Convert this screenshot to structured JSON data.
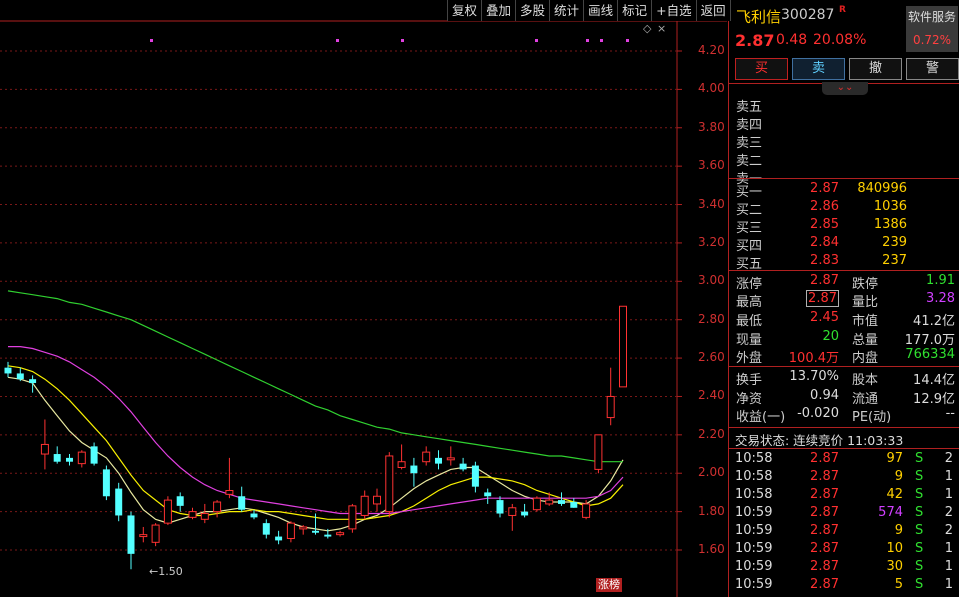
{
  "toolbar": [
    "复权",
    "叠加",
    "多股",
    "统计",
    "画线",
    "标记",
    "+自选",
    "返回"
  ],
  "chart_controls": {
    "diamond": "◇",
    "close": "×"
  },
  "chart_data": {
    "type": "candlestick",
    "yticks": [
      "4.20",
      "4.00",
      "3.80",
      "3.60",
      "3.40",
      "3.20",
      "3.00",
      "2.80",
      "2.60",
      "2.40",
      "2.20",
      "2.00",
      "1.80",
      "1.60"
    ],
    "ylim": [
      1.52,
      4.3
    ],
    "low_annotation": "1.50",
    "badge": "涨榜",
    "candles": [
      {
        "o": 2.55,
        "h": 2.58,
        "l": 2.5,
        "c": 2.52
      },
      {
        "o": 2.52,
        "h": 2.55,
        "l": 2.48,
        "c": 2.49
      },
      {
        "o": 2.49,
        "h": 2.51,
        "l": 2.42,
        "c": 2.47
      },
      {
        "o": 2.1,
        "h": 2.28,
        "l": 2.02,
        "c": 2.15
      },
      {
        "o": 2.1,
        "h": 2.14,
        "l": 2.05,
        "c": 2.06
      },
      {
        "o": 2.08,
        "h": 2.1,
        "l": 2.04,
        "c": 2.06
      },
      {
        "o": 2.05,
        "h": 2.12,
        "l": 2.03,
        "c": 2.11
      },
      {
        "o": 2.14,
        "h": 2.16,
        "l": 2.04,
        "c": 2.05
      },
      {
        "o": 2.02,
        "h": 2.04,
        "l": 1.86,
        "c": 1.88
      },
      {
        "o": 1.92,
        "h": 1.95,
        "l": 1.75,
        "c": 1.78
      },
      {
        "o": 1.78,
        "h": 1.8,
        "l": 1.5,
        "c": 1.58
      },
      {
        "o": 1.67,
        "h": 1.72,
        "l": 1.64,
        "c": 1.68
      },
      {
        "o": 1.64,
        "h": 1.74,
        "l": 1.62,
        "c": 1.73
      },
      {
        "o": 1.74,
        "h": 1.88,
        "l": 1.73,
        "c": 1.86
      },
      {
        "o": 1.88,
        "h": 1.9,
        "l": 1.8,
        "c": 1.83
      },
      {
        "o": 1.77,
        "h": 1.82,
        "l": 1.76,
        "c": 1.8
      },
      {
        "o": 1.76,
        "h": 1.84,
        "l": 1.74,
        "c": 1.79
      },
      {
        "o": 1.8,
        "h": 1.86,
        "l": 1.77,
        "c": 1.85
      },
      {
        "o": 1.89,
        "h": 2.08,
        "l": 1.87,
        "c": 1.91
      },
      {
        "o": 1.88,
        "h": 1.93,
        "l": 1.8,
        "c": 1.81
      },
      {
        "o": 1.79,
        "h": 1.81,
        "l": 1.76,
        "c": 1.77
      },
      {
        "o": 1.74,
        "h": 1.76,
        "l": 1.66,
        "c": 1.68
      },
      {
        "o": 1.67,
        "h": 1.7,
        "l": 1.63,
        "c": 1.65
      },
      {
        "o": 1.66,
        "h": 1.75,
        "l": 1.64,
        "c": 1.74
      },
      {
        "o": 1.71,
        "h": 1.73,
        "l": 1.68,
        "c": 1.72
      },
      {
        "o": 1.7,
        "h": 1.79,
        "l": 1.68,
        "c": 1.69
      },
      {
        "o": 1.68,
        "h": 1.71,
        "l": 1.66,
        "c": 1.67
      },
      {
        "o": 1.68,
        "h": 1.7,
        "l": 1.67,
        "c": 1.69
      },
      {
        "o": 1.71,
        "h": 1.84,
        "l": 1.69,
        "c": 1.83
      },
      {
        "o": 1.78,
        "h": 1.91,
        "l": 1.76,
        "c": 1.88
      },
      {
        "o": 1.84,
        "h": 1.92,
        "l": 1.8,
        "c": 1.88
      },
      {
        "o": 1.8,
        "h": 2.11,
        "l": 1.77,
        "c": 2.09
      },
      {
        "o": 2.03,
        "h": 2.15,
        "l": 2.02,
        "c": 2.06
      },
      {
        "o": 2.04,
        "h": 2.08,
        "l": 1.93,
        "c": 2.0
      },
      {
        "o": 2.06,
        "h": 2.14,
        "l": 2.04,
        "c": 2.11
      },
      {
        "o": 2.08,
        "h": 2.12,
        "l": 2.02,
        "c": 2.05
      },
      {
        "o": 2.07,
        "h": 2.14,
        "l": 2.04,
        "c": 2.08
      },
      {
        "o": 2.05,
        "h": 2.08,
        "l": 2.01,
        "c": 2.02
      },
      {
        "o": 2.04,
        "h": 2.06,
        "l": 1.9,
        "c": 1.93
      },
      {
        "o": 1.9,
        "h": 1.92,
        "l": 1.84,
        "c": 1.88
      },
      {
        "o": 1.86,
        "h": 1.88,
        "l": 1.77,
        "c": 1.79
      },
      {
        "o": 1.78,
        "h": 1.84,
        "l": 1.7,
        "c": 1.82
      },
      {
        "o": 1.8,
        "h": 1.84,
        "l": 1.77,
        "c": 1.78
      },
      {
        "o": 1.81,
        "h": 1.88,
        "l": 1.8,
        "c": 1.87
      },
      {
        "o": 1.84,
        "h": 1.9,
        "l": 1.83,
        "c": 1.86
      },
      {
        "o": 1.86,
        "h": 1.9,
        "l": 1.83,
        "c": 1.84
      },
      {
        "o": 1.85,
        "h": 1.87,
        "l": 1.82,
        "c": 1.82
      },
      {
        "o": 1.77,
        "h": 1.86,
        "l": 1.76,
        "c": 1.84
      },
      {
        "o": 2.02,
        "h": 2.2,
        "l": 2.0,
        "c": 2.2
      },
      {
        "o": 2.29,
        "h": 2.55,
        "l": 2.25,
        "c": 2.4
      },
      {
        "o": 2.45,
        "h": 2.87,
        "l": 2.45,
        "c": 2.87
      }
    ],
    "marker_indices": [
      9,
      21,
      26,
      35,
      39,
      41,
      42
    ],
    "lines": [
      {
        "color": "#e8e8a0",
        "values": [
          2.5,
          2.49,
          2.47,
          2.38,
          2.3,
          2.22,
          2.16,
          2.12,
          2.08,
          2.0,
          1.9,
          1.81,
          1.76,
          1.74,
          1.76,
          1.78,
          1.8,
          1.8,
          1.81,
          1.82,
          1.81,
          1.79,
          1.77,
          1.74,
          1.72,
          1.71,
          1.7,
          1.71,
          1.73,
          1.76,
          1.78,
          1.82,
          1.87,
          1.92,
          1.96,
          1.99,
          2.02,
          2.03,
          2.03,
          1.99,
          1.95,
          1.91,
          1.88,
          1.86,
          1.85,
          1.85,
          1.85,
          1.84,
          1.88,
          1.96,
          2.07
        ]
      },
      {
        "color": "#f8f000",
        "values": [
          2.56,
          2.55,
          2.53,
          2.49,
          2.44,
          2.38,
          2.31,
          2.24,
          2.17,
          2.08,
          1.99,
          1.91,
          1.86,
          1.81,
          1.79,
          1.78,
          1.78,
          1.79,
          1.8,
          1.8,
          1.81,
          1.8,
          1.8,
          1.79,
          1.78,
          1.77,
          1.76,
          1.76,
          1.76,
          1.76,
          1.77,
          1.78,
          1.8,
          1.83,
          1.87,
          1.91,
          1.94,
          1.96,
          1.98,
          1.98,
          1.97,
          1.96,
          1.94,
          1.91,
          1.89,
          1.87,
          1.85,
          1.83,
          1.84,
          1.87,
          1.94
        ]
      },
      {
        "color": "#e040e0",
        "values": [
          2.66,
          2.66,
          2.65,
          2.63,
          2.61,
          2.58,
          2.54,
          2.5,
          2.45,
          2.39,
          2.32,
          2.24,
          2.16,
          2.09,
          2.03,
          1.98,
          1.94,
          1.91,
          1.89,
          1.87,
          1.86,
          1.85,
          1.84,
          1.83,
          1.82,
          1.81,
          1.8,
          1.79,
          1.79,
          1.79,
          1.79,
          1.79,
          1.8,
          1.81,
          1.82,
          1.83,
          1.84,
          1.85,
          1.86,
          1.87,
          1.87,
          1.87,
          1.87,
          1.87,
          1.87,
          1.87,
          1.87,
          1.87,
          1.88,
          1.91,
          1.98
        ]
      },
      {
        "color": "#30d030",
        "values": [
          2.95,
          2.94,
          2.93,
          2.92,
          2.91,
          2.89,
          2.88,
          2.86,
          2.84,
          2.82,
          2.8,
          2.77,
          2.74,
          2.71,
          2.68,
          2.65,
          2.62,
          2.59,
          2.56,
          2.53,
          2.5,
          2.47,
          2.44,
          2.41,
          2.38,
          2.35,
          2.33,
          2.3,
          2.28,
          2.26,
          2.24,
          2.23,
          2.21,
          2.2,
          2.19,
          2.18,
          2.17,
          2.16,
          2.15,
          2.14,
          2.13,
          2.12,
          2.11,
          2.1,
          2.09,
          2.09,
          2.08,
          2.07,
          2.06,
          2.06,
          2.06
        ]
      }
    ]
  },
  "header": {
    "name": "飞利信",
    "code": "300287",
    "flag": "R",
    "service_label": "软件服务",
    "service_pct": "0.72%",
    "price": "2.87",
    "change": "0.48",
    "change_pct": "20.08%"
  },
  "trade_buttons": {
    "buy": "买",
    "sell": "卖",
    "cancel": "撤",
    "alert": "警"
  },
  "expand": "⌄⌄",
  "sell_book": [
    "卖五",
    "卖四",
    "卖三",
    "卖二",
    "卖一"
  ],
  "buy_book": [
    {
      "label": "买一",
      "price": "2.87",
      "vol": "840996"
    },
    {
      "label": "买二",
      "price": "2.86",
      "vol": "1036"
    },
    {
      "label": "买三",
      "price": "2.85",
      "vol": "1386"
    },
    {
      "label": "买四",
      "price": "2.84",
      "vol": "239"
    },
    {
      "label": "买五",
      "price": "2.83",
      "vol": "237"
    }
  ],
  "stats": {
    "limit_up_lbl": "涨停",
    "limit_up": "2.87",
    "limit_down_lbl": "跌停",
    "limit_down": "1.91",
    "high_lbl": "最高",
    "high": "2.87",
    "vol_ratio_lbl": "量比",
    "vol_ratio": "3.28",
    "low_lbl": "最低",
    "low": "2.45",
    "mktcap_lbl": "市值",
    "mktcap": "41.2亿",
    "cur_vol_lbl": "现量",
    "cur_vol": "20",
    "total_vol_lbl": "总量",
    "total_vol": "177.0万",
    "outer_lbl": "外盘",
    "outer": "100.4万",
    "inner_lbl": "内盘",
    "inner": "766334",
    "turnover_lbl": "换手",
    "turnover": "13.70%",
    "equity_lbl": "股本",
    "equity": "14.4亿",
    "nav_lbl": "净资",
    "nav": "0.94",
    "float_lbl": "流通",
    "float": "12.9亿",
    "eps_lbl": "收益(一)",
    "eps": "-0.020",
    "pe_lbl": "PE(动)",
    "pe": "--"
  },
  "trade_status": "交易状态: 连续竞价 11:03:33",
  "ticks": [
    {
      "time": "10:58",
      "price": "2.87",
      "vol": "97",
      "dir": "S",
      "cnt": "2",
      "vcolor": "yellow"
    },
    {
      "time": "10:58",
      "price": "2.87",
      "vol": "9",
      "dir": "S",
      "cnt": "1",
      "vcolor": "yellow"
    },
    {
      "time": "10:58",
      "price": "2.87",
      "vol": "42",
      "dir": "S",
      "cnt": "1",
      "vcolor": "yellow"
    },
    {
      "time": "10:59",
      "price": "2.87",
      "vol": "574",
      "dir": "S",
      "cnt": "2",
      "vcolor": "purple"
    },
    {
      "time": "10:59",
      "price": "2.87",
      "vol": "9",
      "dir": "S",
      "cnt": "2",
      "vcolor": "yellow"
    },
    {
      "time": "10:59",
      "price": "2.87",
      "vol": "10",
      "dir": "S",
      "cnt": "1",
      "vcolor": "yellow"
    },
    {
      "time": "10:59",
      "price": "2.87",
      "vol": "30",
      "dir": "S",
      "cnt": "1",
      "vcolor": "yellow"
    },
    {
      "time": "10:59",
      "price": "2.87",
      "vol": "5",
      "dir": "S",
      "cnt": "1",
      "vcolor": "yellow"
    }
  ]
}
